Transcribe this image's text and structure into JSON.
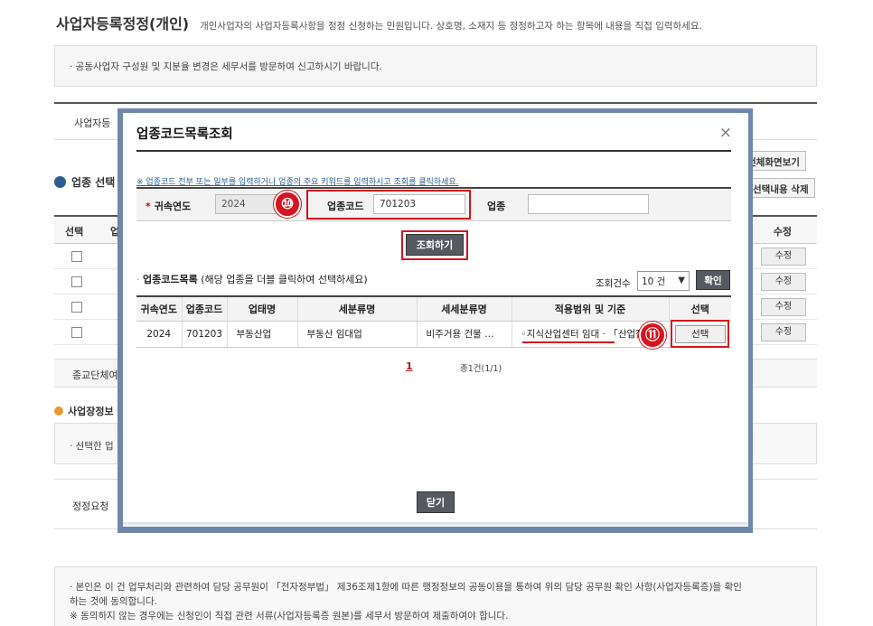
{
  "background": {
    "title": "사업자등록정정(개인)",
    "subtitle": "개인사업자의 사업자등록사항을 정정 신청하는 민원입니다. 상호명, 소재지 등 정정하고자 하는 항목에 내용을 직접 입력하세요.",
    "notice": "· 공동사업자 구성원 및 지분율 변경은 세무서를 방문하여 신고하시기 바랍니다.",
    "biz_label": "사업자등",
    "btn_fullscreen": "전체화면보기",
    "btn_delete": "선택내용 삭제",
    "section_title": "업종 선택",
    "table_headers": [
      "선택",
      "업",
      "수정"
    ],
    "rows": [
      {
        "edit": "수정"
      },
      {
        "edit": "수정"
      },
      {
        "edit": "수정"
      },
      {
        "edit": "수정"
      }
    ],
    "religion_label": "종교단체여",
    "biz_info_section": "사업장정보",
    "selected_note": "· 선택한 업",
    "correction_label": "정정요청",
    "agree_line1": "· 본인은 이 건 업무처리와 관련하여 담당 공무원이 「전자정부법」 제36조제1항에 따른 행정정보의 공동이용을 통하여 위의 담당 공무원 확인 사항(사업자등록증)을 확인",
    "agree_line2": "하는 것에 동의합니다.",
    "agree_line3": "※ 동의하지 않는 경우에는 신청인이 직접 관련 서류(사업자등록증 원본)를 세무서 방문하여 제출하여야 합니다."
  },
  "modal": {
    "title": "업종코드목록조회",
    "close_icon": "×",
    "hint": "※ 업종코드 전부 또는 일부를 입력하거나 업종의 주요 키워드를 입력하시고 조회를 클릭하세요.",
    "search": {
      "year_label": "귀속연도",
      "year_value": "2024",
      "code_label": "업종코드",
      "code_value": "701203",
      "industry_label": "업종",
      "industry_value": ""
    },
    "query_button": "조회하기",
    "annotation_10": "⑩",
    "annotation_11": "⑪",
    "list_title": "업종코드목록",
    "list_desc": "(해당 업종을 더블 클릭하여 선택하세요)",
    "count_label": "조회건수",
    "count_value": "10 건",
    "confirm_button": "확인",
    "columns": [
      "귀속연도",
      "업종코드",
      "업태명",
      "세분류명",
      "세세분류명",
      "적용범위 및 기준",
      "선택"
    ],
    "results": [
      {
        "year": "2024",
        "code": "701203",
        "business": "부동산업",
        "sub": "부동산 임대업",
        "subsub": "비주거용 건물 …",
        "scope": "◦지식산업센터 임대 · 「산업집",
        "select": "선택"
      }
    ],
    "page": "1",
    "total": "총1건(1/1)",
    "close_button": "닫기"
  }
}
